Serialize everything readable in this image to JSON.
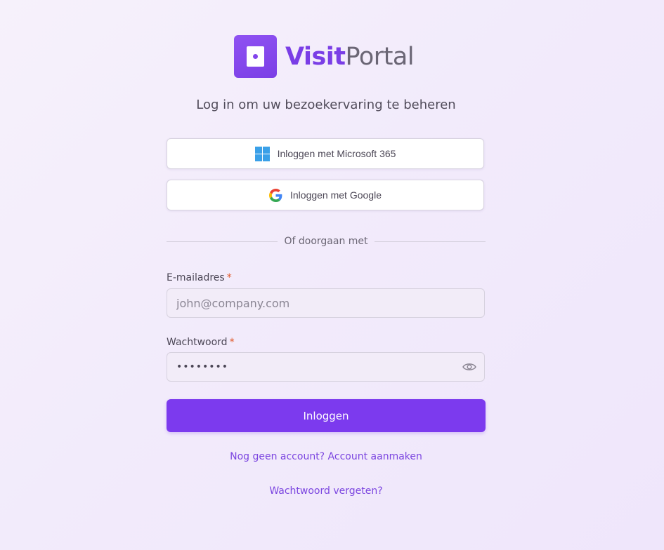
{
  "logo": {
    "word_bold": "Visit",
    "word_light": "Portal"
  },
  "subtitle": "Log in om uw bezoekervaring te beheren",
  "sso": {
    "microsoft_label": "Inloggen met Microsoft 365",
    "google_label": "Inloggen met Google"
  },
  "divider_text": "Of doorgaan met",
  "email": {
    "label": "E-mailadres",
    "required_mark": "*",
    "placeholder": "john@company.com",
    "value": ""
  },
  "password": {
    "label": "Wachtwoord",
    "required_mark": "*",
    "value": "12345678"
  },
  "login_button": "Inloggen",
  "signup_link": "Nog geen account? Account aanmaken",
  "forgot_link": "Wachtwoord vergeten?",
  "colors": {
    "brand_purple": "#7c3aee",
    "required": "#e0592a",
    "link": "#7b45e0"
  },
  "icons": {
    "logo": "door-icon",
    "microsoft": "microsoft-logo-icon",
    "google": "google-logo-icon",
    "password_toggle": "eye-icon"
  }
}
